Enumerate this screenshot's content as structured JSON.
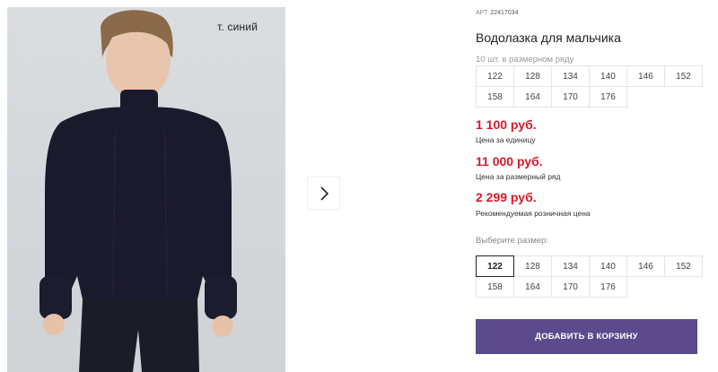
{
  "gallery": {
    "color_label": "т. синий",
    "next_icon": "chevron-right-icon"
  },
  "product": {
    "art_label": "АРТ",
    "art_value": "22417034",
    "title": "Водолазка для мальчика",
    "row_label": "10 шт. в размерном ряду",
    "row_sizes": [
      "122",
      "128",
      "134",
      "140",
      "146",
      "152",
      "158",
      "164",
      "170",
      "176"
    ]
  },
  "prices": {
    "unit_price": "1 100 руб.",
    "unit_note": "Цена за единицу",
    "row_price": "11 000 руб.",
    "row_note": "Цена за размерный ряд",
    "retail_price": "2 299 руб.",
    "retail_note": "Рекомендуемая розничная цена"
  },
  "size_select": {
    "label": "Выберите размер:",
    "sizes": [
      "122",
      "128",
      "134",
      "140",
      "146",
      "152",
      "158",
      "164",
      "170",
      "176"
    ],
    "selected": "122"
  },
  "cart": {
    "button_label": "ДОБАВИТЬ В КОРЗИНУ"
  },
  "colors": {
    "price": "#d9182a",
    "cart_button": "#5b4a8c"
  }
}
